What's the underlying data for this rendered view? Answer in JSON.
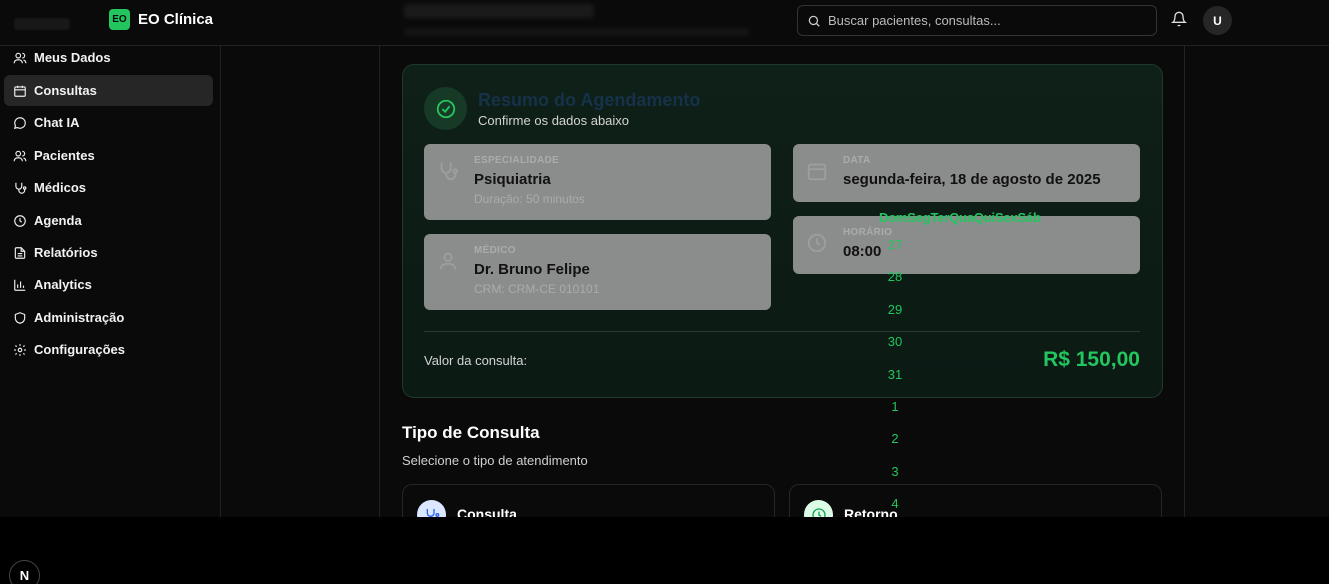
{
  "brand": {
    "logo_text": "EO",
    "name": "EO Clínica",
    "logo_color": "#22c55e"
  },
  "search": {
    "placeholder": "Buscar pacientes, consultas..."
  },
  "user": {
    "avatar_initial": "U"
  },
  "sidebar": {
    "items": [
      {
        "label": "Meus Dados",
        "icon": "users-icon",
        "active": false
      },
      {
        "label": "Consultas",
        "icon": "calendar-icon",
        "active": true
      },
      {
        "label": "Chat IA",
        "icon": "chat-icon",
        "active": false
      },
      {
        "label": "Pacientes",
        "icon": "users-icon",
        "active": false
      },
      {
        "label": "Médicos",
        "icon": "stethoscope-icon",
        "active": false
      },
      {
        "label": "Agenda",
        "icon": "clock-icon",
        "active": false
      },
      {
        "label": "Relatórios",
        "icon": "file-icon",
        "active": false
      },
      {
        "label": "Analytics",
        "icon": "bar-chart-icon",
        "active": false
      },
      {
        "label": "Administração",
        "icon": "shield-icon",
        "active": false
      },
      {
        "label": "Configurações",
        "icon": "gear-icon",
        "active": false
      }
    ]
  },
  "summary": {
    "title": "Resumo do Agendamento",
    "subtitle": "Confirme os dados abaixo",
    "especialidade": {
      "label": "ESPECIALIDADE",
      "value": "Psiquiatria",
      "sub": "Duração: 50 minutos"
    },
    "medico": {
      "label": "MÉDICO",
      "value": "Dr. Bruno Felipe",
      "sub": "CRM: CRM-CE 010101"
    },
    "data": {
      "label": "DATA",
      "value": "segunda-feira, 18 de agosto de 2025"
    },
    "horario": {
      "label": "HORÁRIO",
      "value": "08:00"
    },
    "price_label": "Valor da consulta:",
    "price": "R$ 150,00",
    "accent": "#22c55e"
  },
  "tipo": {
    "title": "Tipo de Consulta",
    "subtitle": "Selecione o tipo de atendimento",
    "options": [
      {
        "label": "Consulta",
        "icon": "stethoscope-icon"
      },
      {
        "label": "Retorno",
        "icon": "clock-icon"
      }
    ]
  },
  "calendar_overlay": {
    "weekdays": "DomSegTerQuaQuiSexSáb",
    "days": [
      "27",
      "28",
      "29",
      "30",
      "31",
      "1",
      "2",
      "3",
      "4"
    ]
  },
  "dev_badge": "N"
}
